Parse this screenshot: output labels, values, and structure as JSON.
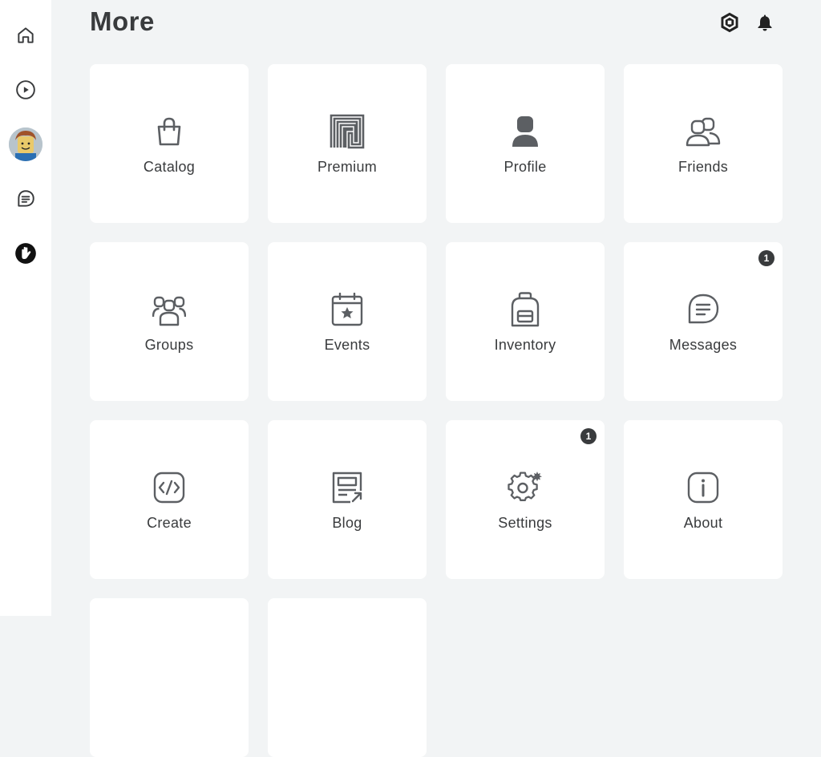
{
  "header": {
    "title": "More",
    "robux_icon": "robux-icon",
    "bell_icon": "notification-bell-icon"
  },
  "sidebar": {
    "items": [
      {
        "name": "home",
        "icon": "home-icon"
      },
      {
        "name": "discover",
        "icon": "play-icon"
      },
      {
        "name": "avatar",
        "icon": "avatar-icon"
      },
      {
        "name": "chat",
        "icon": "chat-icon"
      },
      {
        "name": "more",
        "icon": "more-hand-icon"
      }
    ]
  },
  "tiles": [
    {
      "label": "Catalog",
      "icon": "shopping-bag-icon",
      "badge": ""
    },
    {
      "label": "Premium",
      "icon": "premium-icon",
      "badge": ""
    },
    {
      "label": "Profile",
      "icon": "profile-icon",
      "badge": ""
    },
    {
      "label": "Friends",
      "icon": "friends-icon",
      "badge": ""
    },
    {
      "label": "Groups",
      "icon": "groups-icon",
      "badge": ""
    },
    {
      "label": "Events",
      "icon": "calendar-star-icon",
      "badge": ""
    },
    {
      "label": "Inventory",
      "icon": "backpack-icon",
      "badge": ""
    },
    {
      "label": "Messages",
      "icon": "message-icon",
      "badge": "1"
    },
    {
      "label": "Create",
      "icon": "code-icon",
      "badge": ""
    },
    {
      "label": "Blog",
      "icon": "blog-icon",
      "badge": ""
    },
    {
      "label": "Settings",
      "icon": "gear-icon",
      "badge": "1"
    },
    {
      "label": "About",
      "icon": "info-icon",
      "badge": ""
    },
    {
      "label": "",
      "icon": "",
      "badge": ""
    },
    {
      "label": "",
      "icon": "",
      "badge": ""
    }
  ],
  "colors": {
    "background": "#f2f4f5",
    "tile": "#ffffff",
    "text": "#393b3d",
    "icon": "#5c5f63"
  }
}
